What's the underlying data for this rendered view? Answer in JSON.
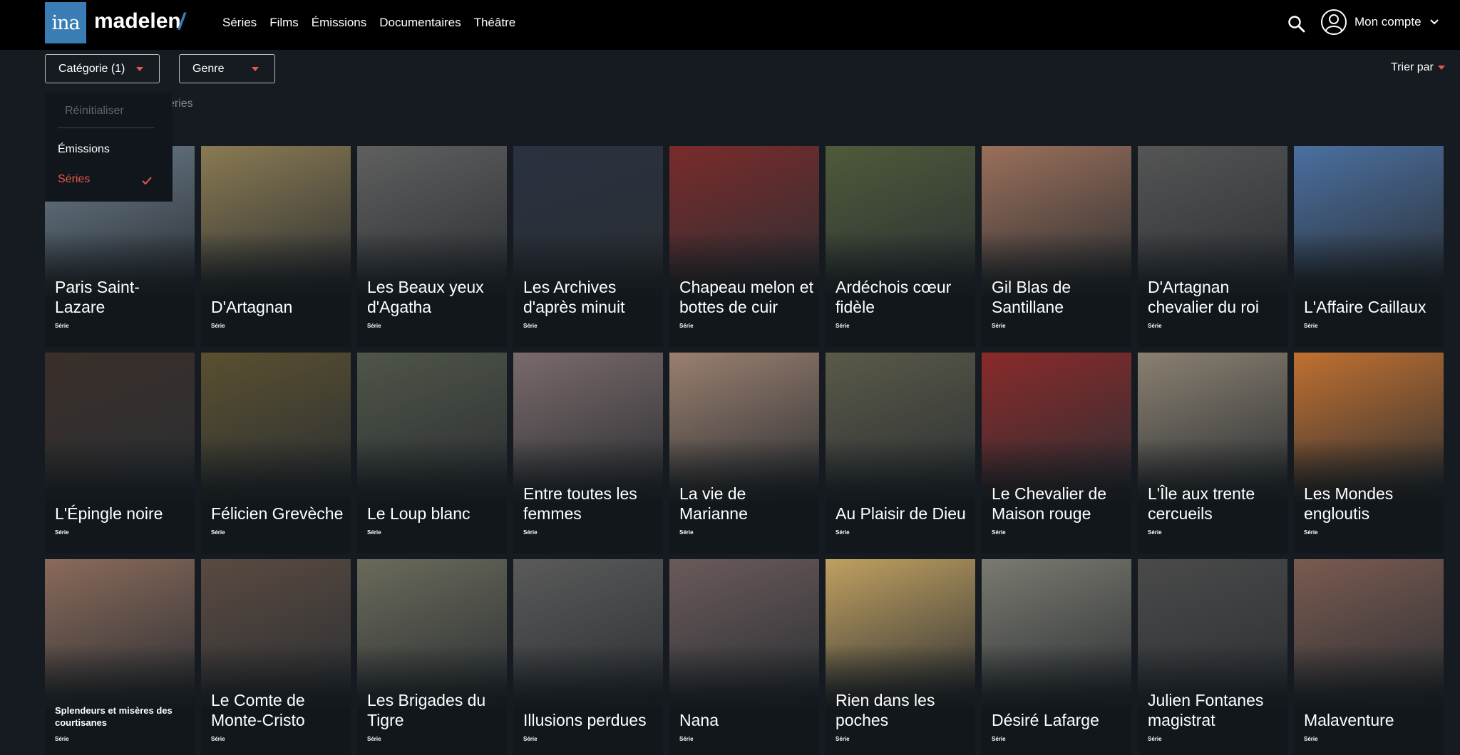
{
  "header": {
    "logo": "ina",
    "brand": "madelen",
    "brand_slash": "/",
    "nav": [
      "Séries",
      "Films",
      "Émissions",
      "Documentaires",
      "Théâtre"
    ],
    "search_icon": "search-icon",
    "account_label": "Mon compte"
  },
  "filters": {
    "category_label": "Catégorie (1)",
    "genre_label": "Genre",
    "sort_label": "Trier par",
    "accent_color": "#e8594a"
  },
  "breadcrumb_text": "éries",
  "dropdown": {
    "reset": "Réinitialiser",
    "options": [
      "Émissions",
      "Séries"
    ],
    "selected": "Séries"
  },
  "cards": [
    {
      "title": "Paris Saint-Lazare",
      "type": "Série"
    },
    {
      "title": "D'Artagnan",
      "type": "Série"
    },
    {
      "title": "Les Beaux yeux d'Agatha",
      "type": "Série"
    },
    {
      "title": "Les Archives d'après minuit",
      "type": "Série"
    },
    {
      "title": "Chapeau melon et bottes de cuir",
      "type": "Série"
    },
    {
      "title": "Ardéchois cœur fidèle",
      "type": "Série"
    },
    {
      "title": "Gil Blas de Santillane",
      "type": "Série"
    },
    {
      "title": "D'Artagnan chevalier du roi",
      "type": "Série"
    },
    {
      "title": "L'Affaire Caillaux",
      "type": "Série"
    },
    {
      "title": "L'Épingle noire",
      "type": "Série"
    },
    {
      "title": "Félicien Grevèche",
      "type": "Série"
    },
    {
      "title": "Le Loup blanc",
      "type": "Série"
    },
    {
      "title": "Entre toutes les femmes",
      "type": "Série"
    },
    {
      "title": "La vie de Marianne",
      "type": "Série"
    },
    {
      "title": "Au Plaisir de Dieu",
      "type": "Série"
    },
    {
      "title": "Le Chevalier de Maison rouge",
      "type": "Série"
    },
    {
      "title": "L'Île aux trente cercueils",
      "type": "Série"
    },
    {
      "title": "Les Mondes engloutis",
      "type": "Série"
    },
    {
      "title": "Splendeurs et misères des courtisanes",
      "type": "Série"
    },
    {
      "title": "Le Comte de Monte-Cristo",
      "type": "Série"
    },
    {
      "title": "Les Brigades du Tigre",
      "type": "Série"
    },
    {
      "title": "Illusions perdues",
      "type": "Série"
    },
    {
      "title": "Nana",
      "type": "Série"
    },
    {
      "title": "Rien dans les poches",
      "type": "Série"
    },
    {
      "title": "Désiré Lafarge",
      "type": "Série"
    },
    {
      "title": "Julien Fontanes magistrat",
      "type": "Série"
    },
    {
      "title": "Malaventure",
      "type": "Série"
    }
  ],
  "card_image_palette": [
    "#6b7d8c",
    "#8a7a52",
    "#5f5f5f",
    "#2a3140",
    "#7a2b2b",
    "#4f5a3a",
    "#9a6f5a",
    "#555555",
    "#4a6fa0",
    "#3a2f2a",
    "#5a5030",
    "#4f5548",
    "#7a6a6a",
    "#9a7f6f",
    "#5a5a48",
    "#8a2a2a",
    "#8a8070",
    "#c07030",
    "#8a6a5a",
    "#5a4a40",
    "#6a6a5a",
    "#5a5a5a",
    "#6a5a5a",
    "#c0a060",
    "#7a7a70",
    "#4a4a4a",
    "#7a5a50"
  ]
}
